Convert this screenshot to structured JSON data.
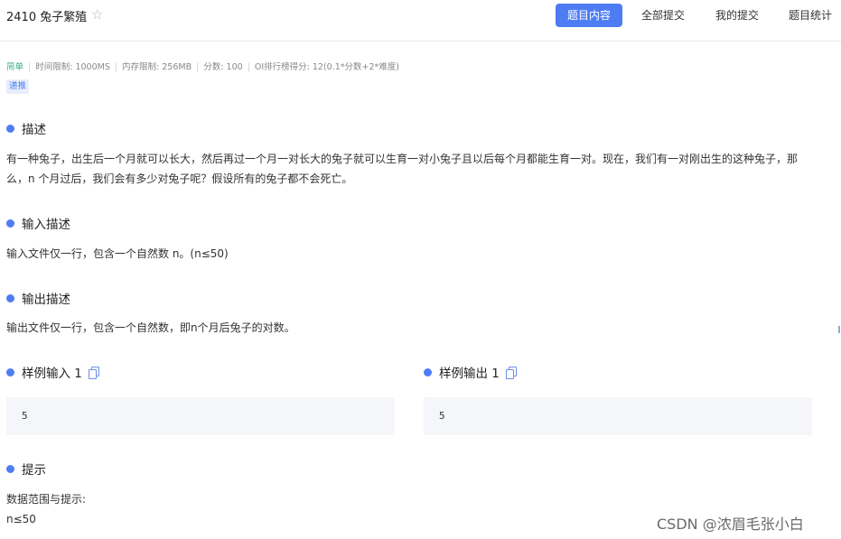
{
  "header": {
    "problem_title": "2410 兔子繁殖",
    "tabs": [
      "题目内容",
      "全部提交",
      "我的提交",
      "题目统计"
    ]
  },
  "meta": {
    "difficulty": "简单",
    "time_limit": "时间限制: 1000MS",
    "memory_limit": "内存限制: 256MB",
    "score": "分数: 100",
    "ranking": "OI排行榜得分: 12(0.1*分数+2*难度)",
    "tag": "递推"
  },
  "sections": {
    "description_title": "描述",
    "description_line1": "有一种兔子，出生后一个月就可以长大，然后再过一个月一对长大的兔子就可以生育一对小兔子且以后每个月都能生育一对。现在，我们有一对刚出生的这种兔子，那",
    "description_line2": "么，n 个月过后，我们会有多少对兔子呢？假设所有的兔子都不会死亡。",
    "input_title": "输入描述",
    "input_text": "输入文件仅一行，包含一个自然数 n。(n≤50)",
    "output_title": "输出描述",
    "output_text": "输出文件仅一行，包含一个自然数，即n个月后兔子的对数。",
    "sample_input_title": "样例输入 1",
    "sample_input_value": "5",
    "sample_output_title": "样例输出 1",
    "sample_output_value": "5",
    "hint_title": "提示",
    "hint_line1": "数据范围与提示:",
    "hint_line2": "n≤50"
  },
  "watermark": "CSDN @浓眉毛张小白",
  "colors": {
    "accent": "#4d7cf5",
    "difficulty": "#36b37e"
  }
}
